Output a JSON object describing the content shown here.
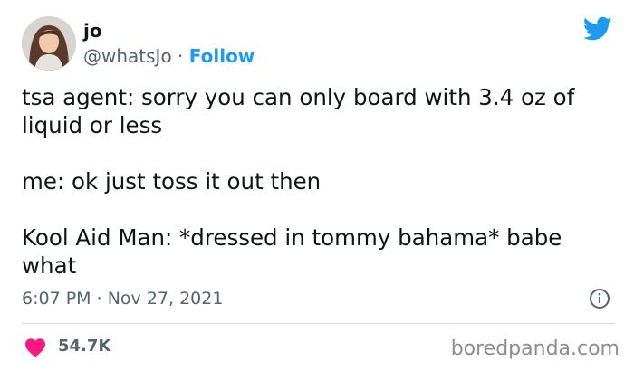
{
  "author": {
    "display_name": "jo",
    "handle": "@whatsJo",
    "separator": "·",
    "follow_label": "Follow"
  },
  "brand_icon": "twitter-bird-icon",
  "tweet": {
    "text": "tsa agent: sorry you can only board with 3.4 oz of\nliquid or less\n\nme: ok just toss it out then\n\nKool Aid Man: *dressed in tommy bahama* babe\nwhat"
  },
  "meta": {
    "time": "6:07 PM",
    "separator": "·",
    "date": "Nov 27, 2021"
  },
  "actions": {
    "likes": "54.7K"
  },
  "watermark": "boredpanda.com",
  "colors": {
    "accent": "#1d9bf0",
    "heart": "#f91880",
    "text": "#0f1419",
    "muted": "#536471"
  }
}
